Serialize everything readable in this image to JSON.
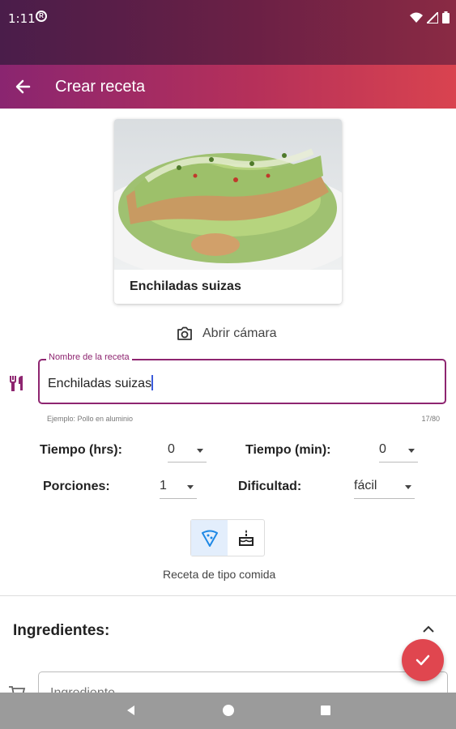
{
  "status_bar": {
    "time": "1:11",
    "notification_icon": "app-notification-icon",
    "icons": [
      "wifi-icon",
      "signal-icon",
      "battery-icon"
    ]
  },
  "app_bar": {
    "back_icon": "arrow-back-icon",
    "title": "Crear receta"
  },
  "recipe_card": {
    "image": "enchiladas-photo",
    "title": "Enchiladas suizas"
  },
  "camera_button": {
    "icon": "camera-icon",
    "label": "Abrir cámara"
  },
  "name_field": {
    "icon": "fork-knife-icon",
    "label": "Nombre de la receta",
    "value": "Enchiladas suizas",
    "helper": "Ejemplo: Pollo en aluminio",
    "counter": "17/80"
  },
  "time_hours": {
    "label": "Tiempo (hrs):",
    "value": "0"
  },
  "time_minutes": {
    "label": "Tiempo (min):",
    "value": "0"
  },
  "portions": {
    "label": "Porciones:",
    "value": "1"
  },
  "difficulty": {
    "label": "Dificultad:",
    "value": "fácil"
  },
  "recipe_type": {
    "options": [
      "pizza-icon",
      "cake-icon"
    ],
    "selected": "pizza-icon",
    "caption": "Receta de tipo comida"
  },
  "ingredients": {
    "title": "Ingredientes:",
    "toggle_icon": "chevron-up-icon",
    "input_icon": "cart-icon",
    "input_placeholder": "Ingrediente"
  },
  "fab": {
    "icon": "check-icon"
  },
  "nav_bar": {
    "icons": [
      "back-triangle-icon",
      "home-circle-icon",
      "recents-square-icon"
    ]
  },
  "colors": {
    "primary": "#8e2570",
    "accent": "#e0464f",
    "selection": "#e3eefc"
  }
}
